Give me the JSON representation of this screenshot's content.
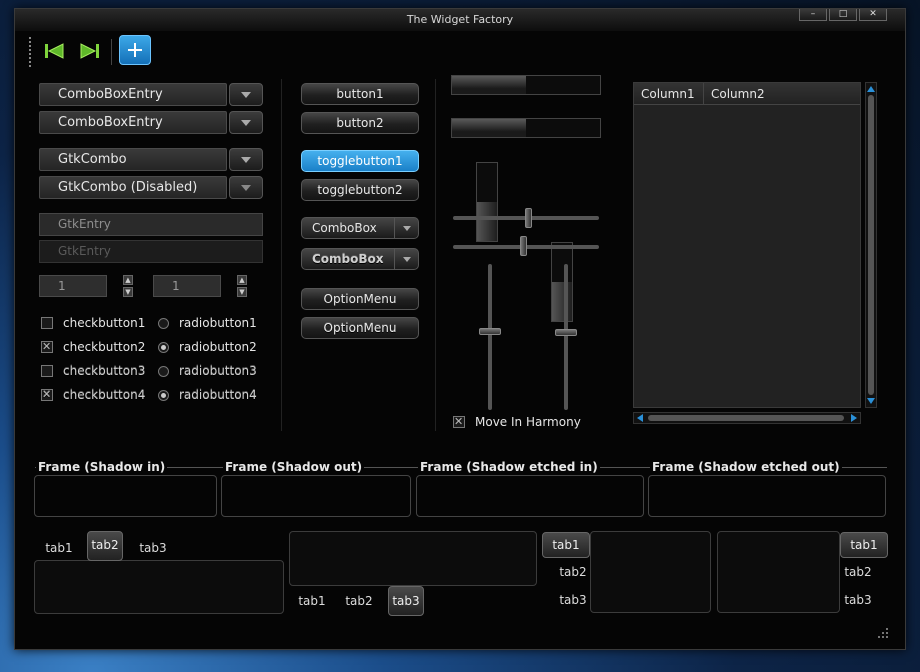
{
  "window": {
    "title": "The Widget Factory"
  },
  "toolbar": {
    "buttons": [
      "go-first-icon",
      "go-last-icon",
      "add-icon"
    ]
  },
  "combos": [
    {
      "label": "ComboBoxEntry"
    },
    {
      "label": "ComboBoxEntry"
    },
    {
      "label": "GtkCombo"
    },
    {
      "label": "GtkCombo (Disabled)"
    }
  ],
  "entries": [
    {
      "placeholder": "GtkEntry"
    },
    {
      "placeholder": "GtkEntry"
    }
  ],
  "spins": [
    {
      "value": "1"
    },
    {
      "value": "1"
    }
  ],
  "checks": [
    {
      "label": "checkbutton1",
      "checked": false
    },
    {
      "label": "checkbutton2",
      "checked": true
    },
    {
      "label": "checkbutton3",
      "checked": false
    },
    {
      "label": "checkbutton4",
      "checked": true
    }
  ],
  "radios": [
    {
      "label": "radiobutton1",
      "selected": false
    },
    {
      "label": "radiobutton2",
      "selected": true
    },
    {
      "label": "radiobutton3",
      "selected": false
    },
    {
      "label": "radiobutton4",
      "selected": true
    }
  ],
  "buttons": {
    "button1": "button1",
    "button2": "button2",
    "toggle1": "togglebutton1",
    "toggle2": "togglebutton2",
    "combo1": "ComboBox",
    "combo2": "ComboBox",
    "option1": "OptionMenu",
    "option2": "OptionMenu"
  },
  "progress": {
    "h1": 0.5,
    "h2": 0.5,
    "v1": 0.5,
    "v2": 0.5
  },
  "harmony": {
    "label": "Move In Harmony",
    "checked": true
  },
  "tree": {
    "col1": "Column1",
    "col2": "Column2"
  },
  "frames": [
    "Frame (Shadow in)",
    "Frame (Shadow out)",
    "Frame (Shadow etched in)",
    "Frame (Shadow etched out)"
  ],
  "notebooks": {
    "nb1": [
      "tab1",
      "tab2",
      "tab3"
    ],
    "nb2": [
      "tab1",
      "tab2",
      "tab3"
    ],
    "nb3": [
      "tab1",
      "tab2",
      "tab3"
    ],
    "nb4": [
      "tab1",
      "tab2",
      "tab3"
    ]
  },
  "colors": {
    "accent": "#2a90d8",
    "background": "#050505"
  }
}
